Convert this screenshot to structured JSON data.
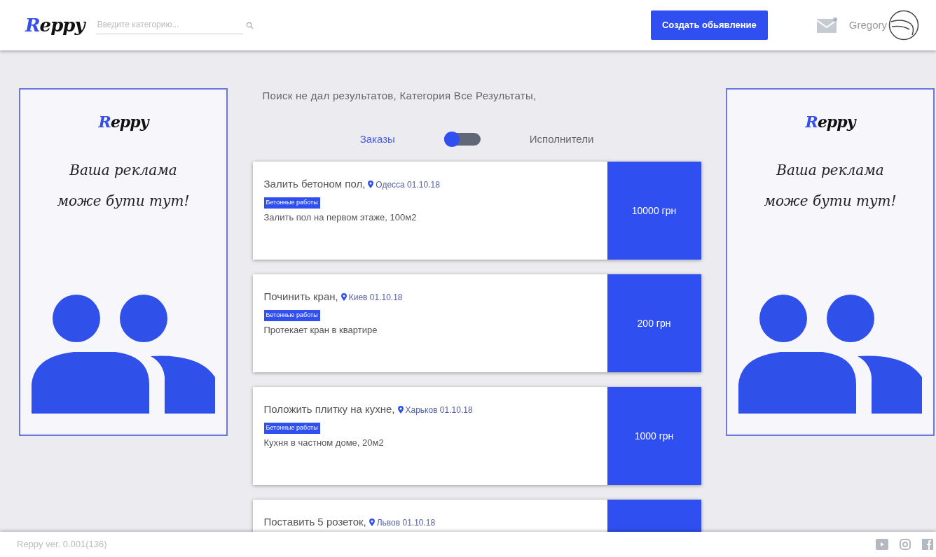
{
  "header": {
    "logo": {
      "initial": "R",
      "rest": "eppy"
    },
    "search": {
      "placeholder": "Введите категорию..."
    },
    "create_button": "Создать обьявление",
    "user": {
      "name": "Gregory"
    }
  },
  "ads": [
    {
      "logo": {
        "initial": "R",
        "rest": "eppy"
      },
      "lines": [
        "Ваша реклама",
        "може бути тут!"
      ]
    },
    {
      "logo": {
        "initial": "R",
        "rest": "eppy"
      },
      "lines": [
        "Ваша реклама",
        "може бути тут!"
      ]
    }
  ],
  "results_message": "Поиск не дал результатов, Категория Все Результаты,",
  "toggle": {
    "options": [
      {
        "label": "Заказы",
        "selected": true
      },
      {
        "label": "Исполнители",
        "selected": false
      }
    ]
  },
  "orders": [
    {
      "title": "Залить бетоном пол,",
      "location": "Одесса 01.10.18",
      "tag": "Бетонные работы",
      "description": "Залить пол на первом этаже, 100м2",
      "price": "10000 грн"
    },
    {
      "title": "Починить кран,",
      "location": "Киев 01.10.18",
      "tag": "Бетонные работы",
      "description": "Протекает кран в квартире",
      "price": "200 грн"
    },
    {
      "title": "Положить плитку на кухне,",
      "location": "Харьков 01.10.18",
      "tag": "Бетонные работы",
      "description": "Кухня в частном доме, 20м2",
      "price": "1000 грн"
    },
    {
      "title": "Поставить 5 розеток,",
      "location": "Львов 01.10.18"
    }
  ],
  "footer": {
    "version": "Reppy ver. 0.001(136)"
  }
}
